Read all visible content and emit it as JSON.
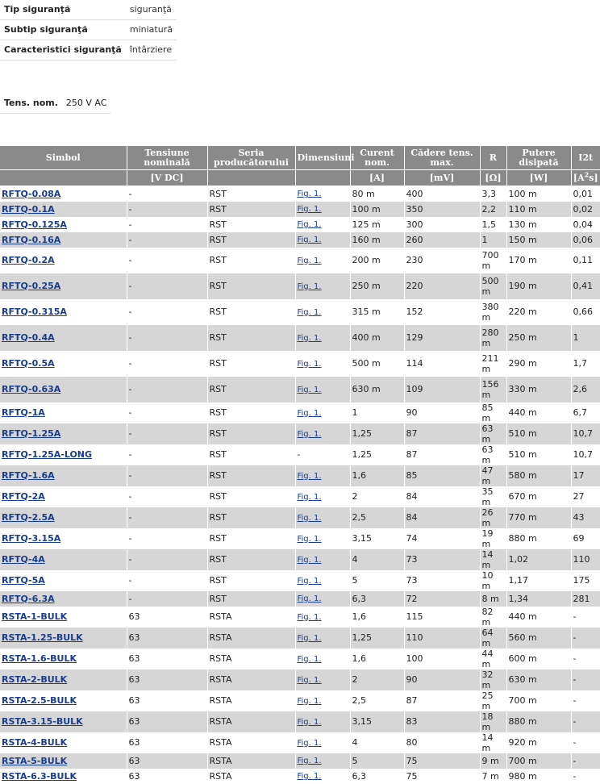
{
  "attributes": [
    {
      "label": "Tip siguranţă",
      "value": "siguranţă"
    },
    {
      "label": "Subtip siguranţă",
      "value": "miniatură"
    },
    {
      "label": "Caracteristici siguranţă",
      "value": "întârziere"
    }
  ],
  "nominal": {
    "label": "Tens. nom.",
    "value": "250 V AC"
  },
  "table": {
    "headers": [
      {
        "label": "Simbol",
        "unit": ""
      },
      {
        "label": "Tensiune nominală",
        "unit": "[V DC]"
      },
      {
        "label": "Seria producătorului",
        "unit": ""
      },
      {
        "label": "Dimensiuni",
        "unit": ""
      },
      {
        "label": "Curent nom.",
        "unit": "[A]"
      },
      {
        "label": "Cădere tens. max.",
        "unit": "[mV]"
      },
      {
        "label": "R",
        "unit": "[Ω]"
      },
      {
        "label": "Putere disipată",
        "unit": "[W]"
      },
      {
        "label": "I2t",
        "unit": "[A",
        "unit_sup": "2",
        "unit_end": "s]"
      }
    ],
    "rows": [
      {
        "symbol": "RFTQ-0.08A",
        "voltage": "-",
        "series": "RST",
        "dim": "Fig. 1.",
        "current": "80 m",
        "drop": "400",
        "r": "3,3",
        "power": "100 m",
        "i2t": "0,01"
      },
      {
        "symbol": "RFTQ-0.1A",
        "voltage": "-",
        "series": "RST",
        "dim": "Fig. 1.",
        "current": "100 m",
        "drop": "350",
        "r": "2,2",
        "power": "110 m",
        "i2t": "0,02"
      },
      {
        "symbol": "RFTQ-0.125A",
        "voltage": "-",
        "series": "RST",
        "dim": "Fig. 1.",
        "current": "125 m",
        "drop": "300",
        "r": "1,5",
        "power": "130 m",
        "i2t": "0,04"
      },
      {
        "symbol": "RFTQ-0.16A",
        "voltage": "-",
        "series": "RST",
        "dim": "Fig. 1.",
        "current": "160 m",
        "drop": "260",
        "r": "1",
        "power": "150 m",
        "i2t": "0,06"
      },
      {
        "symbol": "RFTQ-0.2A",
        "voltage": "-",
        "series": "RST",
        "dim": "Fig. 1.",
        "current": "200 m",
        "drop": "230",
        "r": "700 m",
        "power": "170 m",
        "i2t": "0,11"
      },
      {
        "symbol": "RFTQ-0.25A",
        "voltage": "-",
        "series": "RST",
        "dim": "Fig. 1.",
        "current": "250 m",
        "drop": "220",
        "r": "500 m",
        "power": "190 m",
        "i2t": "0,41"
      },
      {
        "symbol": "RFTQ-0.315A",
        "voltage": "-",
        "series": "RST",
        "dim": "Fig. 1.",
        "current": "315 m",
        "drop": "152",
        "r": "380 m",
        "power": "220 m",
        "i2t": "0,66"
      },
      {
        "symbol": "RFTQ-0.4A",
        "voltage": "-",
        "series": "RST",
        "dim": "Fig. 1.",
        "current": "400 m",
        "drop": "129",
        "r": "280 m",
        "power": "250 m",
        "i2t": "1"
      },
      {
        "symbol": "RFTQ-0.5A",
        "voltage": "-",
        "series": "RST",
        "dim": "Fig. 1.",
        "current": "500 m",
        "drop": "114",
        "r": "211 m",
        "power": "290 m",
        "i2t": "1,7"
      },
      {
        "symbol": "RFTQ-0.63A",
        "voltage": "-",
        "series": "RST",
        "dim": "Fig. 1.",
        "current": "630 m",
        "drop": "109",
        "r": "156 m",
        "power": "330 m",
        "i2t": "2,6"
      },
      {
        "symbol": "RFTQ-1A",
        "voltage": "-",
        "series": "RST",
        "dim": "Fig. 1.",
        "current": "1",
        "drop": "90",
        "r": "85 m",
        "power": "440 m",
        "i2t": "6,7"
      },
      {
        "symbol": "RFTQ-1.25A",
        "voltage": "-",
        "series": "RST",
        "dim": "Fig. 1.",
        "current": "1,25",
        "drop": "87",
        "r": "63 m",
        "power": "510 m",
        "i2t": "10,7"
      },
      {
        "symbol": "RFTQ-1.25A-LONG",
        "voltage": "-",
        "series": "RST",
        "dim": "-",
        "current": "1,25",
        "drop": "87",
        "r": "63 m",
        "power": "510 m",
        "i2t": "10,7"
      },
      {
        "symbol": "RFTQ-1.6A",
        "voltage": "-",
        "series": "RST",
        "dim": "Fig. 1.",
        "current": "1,6",
        "drop": "85",
        "r": "47 m",
        "power": "580 m",
        "i2t": "17"
      },
      {
        "symbol": "RFTQ-2A",
        "voltage": "-",
        "series": "RST",
        "dim": "Fig. 1.",
        "current": "2",
        "drop": "84",
        "r": "35 m",
        "power": "670 m",
        "i2t": "27"
      },
      {
        "symbol": "RFTQ-2.5A",
        "voltage": "-",
        "series": "RST",
        "dim": "Fig. 1.",
        "current": "2,5",
        "drop": "84",
        "r": "26 m",
        "power": "770 m",
        "i2t": "43"
      },
      {
        "symbol": "RFTQ-3.15A",
        "voltage": "-",
        "series": "RST",
        "dim": "Fig. 1.",
        "current": "3,15",
        "drop": "74",
        "r": "19 m",
        "power": "880 m",
        "i2t": "69"
      },
      {
        "symbol": "RFTQ-4A",
        "voltage": "-",
        "series": "RST",
        "dim": "Fig. 1.",
        "current": "4",
        "drop": "73",
        "r": "14 m",
        "power": "1,02",
        "i2t": "110"
      },
      {
        "symbol": "RFTQ-5A",
        "voltage": "-",
        "series": "RST",
        "dim": "Fig. 1.",
        "current": "5",
        "drop": "73",
        "r": "10 m",
        "power": "1,17",
        "i2t": "175"
      },
      {
        "symbol": "RFTQ-6.3A",
        "voltage": "-",
        "series": "RST",
        "dim": "Fig. 1.",
        "current": "6,3",
        "drop": "72",
        "r": "8 m",
        "power": "1,34",
        "i2t": "281"
      },
      {
        "symbol": "RSTA-1-BULK",
        "voltage": "63",
        "series": "RSTA",
        "dim": "Fig. 1.",
        "current": "1,6",
        "drop": "115",
        "r": "82 m",
        "power": "440 m",
        "i2t": "-"
      },
      {
        "symbol": "RSTA-1.25-BULK",
        "voltage": "63",
        "series": "RSTA",
        "dim": "Fig. 1.",
        "current": "1,25",
        "drop": "110",
        "r": "64 m",
        "power": "560 m",
        "i2t": "-"
      },
      {
        "symbol": "RSTA-1.6-BULK",
        "voltage": "63",
        "series": "RSTA",
        "dim": "Fig. 1.",
        "current": "1,6",
        "drop": "100",
        "r": "44 m",
        "power": "600 m",
        "i2t": "-"
      },
      {
        "symbol": "RSTA-2-BULK",
        "voltage": "63",
        "series": "RSTA",
        "dim": "Fig. 1.",
        "current": "2",
        "drop": "90",
        "r": "32 m",
        "power": "630 m",
        "i2t": "-"
      },
      {
        "symbol": "RSTA-2.5-BULK",
        "voltage": "63",
        "series": "RSTA",
        "dim": "Fig. 1.",
        "current": "2,5",
        "drop": "87",
        "r": "25 m",
        "power": "700 m",
        "i2t": "-"
      },
      {
        "symbol": "RSTA-3.15-BULK",
        "voltage": "63",
        "series": "RSTA",
        "dim": "Fig. 1.",
        "current": "3,15",
        "drop": "83",
        "r": "18 m",
        "power": "880 m",
        "i2t": "-"
      },
      {
        "symbol": "RSTA-4-BULK",
        "voltage": "63",
        "series": "RSTA",
        "dim": "Fig. 1.",
        "current": "4",
        "drop": "80",
        "r": "14 m",
        "power": "920 m",
        "i2t": "-"
      },
      {
        "symbol": "RSTA-5-BULK",
        "voltage": "63",
        "series": "RSTA",
        "dim": "Fig. 1.",
        "current": "5",
        "drop": "75",
        "r": "9 m",
        "power": "700 m",
        "i2t": "-"
      },
      {
        "symbol": "RSTA-6.3-BULK",
        "voltage": "63",
        "series": "RSTA",
        "dim": "Fig. 1.",
        "current": "6,3",
        "drop": "75",
        "r": "7 m",
        "power": "980 m",
        "i2t": "-"
      }
    ]
  }
}
